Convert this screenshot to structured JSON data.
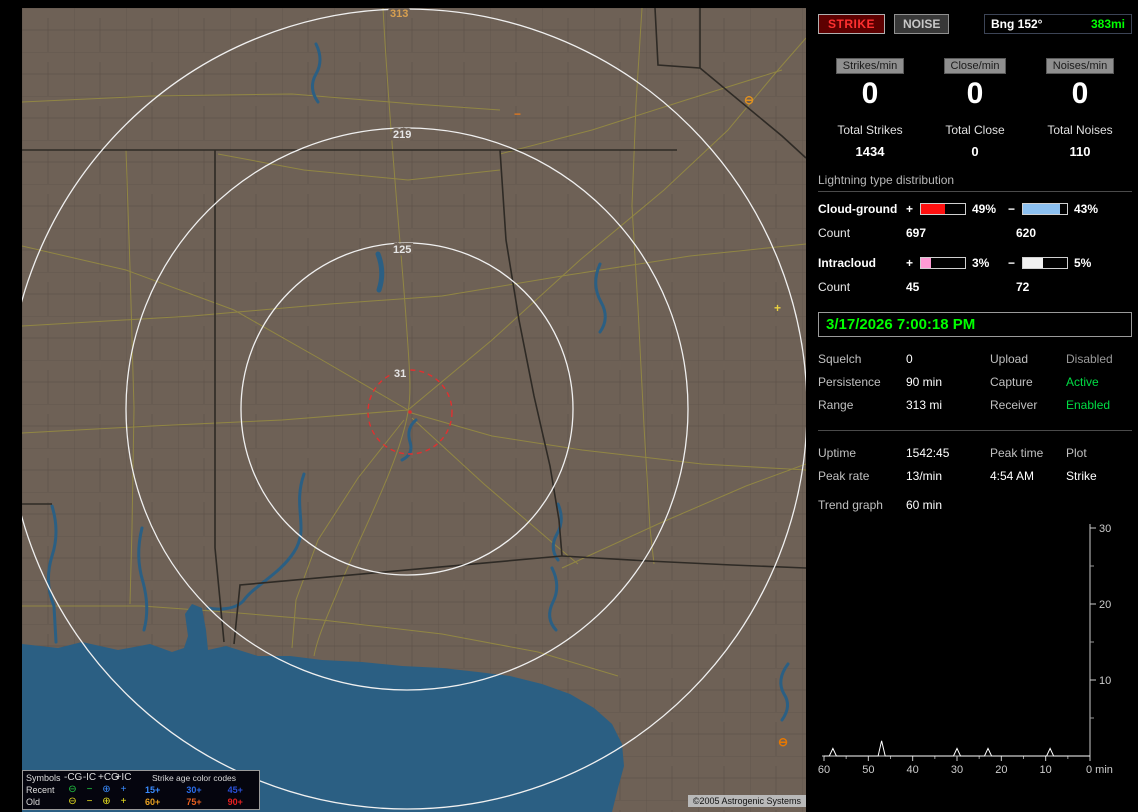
{
  "colors": {
    "accent_green": "#00ff00",
    "status_active": "#00dd44",
    "status_disabled": "#9a9a9a",
    "strike_red": "#ff3030",
    "ring_label": "#e6e6e6",
    "ring_label_outer": "#d8a050",
    "map_land": "#6e6156",
    "map_water": "#2b5f83"
  },
  "map": {
    "rings": [
      {
        "label": "313"
      },
      {
        "label": "219"
      },
      {
        "label": "125"
      },
      {
        "label": "31"
      }
    ],
    "markers": [
      {
        "glyph": "⊖",
        "color": "#e09020"
      },
      {
        "glyph": "−",
        "color": "#e07820"
      },
      {
        "glyph": "+",
        "color": "#e8d040"
      },
      {
        "glyph": "⊖",
        "color": "#e87800"
      }
    ],
    "copyright": "©2005 Astrogenic Systems",
    "legend": {
      "symbols_header": "Symbols",
      "columns": [
        "-CG",
        "-IC",
        "+CG",
        "+IC"
      ],
      "glyphs": [
        "⊖",
        "−",
        "⊕",
        "+"
      ],
      "age_header": "Strike age color codes",
      "recent_label": "Recent",
      "old_label": "Old",
      "recent_ages": [
        "15+",
        "30+",
        "45+"
      ],
      "old_ages": [
        "60+",
        "75+",
        "90+"
      ],
      "recent_symbol_colors": [
        "#22cc44",
        "#22cc44",
        "#3a8cff",
        "#3a8cff"
      ],
      "old_symbol_colors": [
        "#e8e020",
        "#e8e020",
        "#e8e020",
        "#e8e020"
      ],
      "recent_age_colors": [
        "#3a8cff",
        "#2a6ce8",
        "#2a50d8"
      ],
      "old_age_colors": [
        "#e8a020",
        "#e86020",
        "#e82020"
      ]
    }
  },
  "panel": {
    "strike_button": "STRIKE",
    "noise_button": "NOISE",
    "bearing_label": "Bng 152°",
    "bearing_distance": "383mi",
    "counters": [
      {
        "label": "Strikes/min",
        "value": "0",
        "total_label": "Total Strikes",
        "total": "1434"
      },
      {
        "label": "Close/min",
        "value": "0",
        "total_label": "Total Close",
        "total": "0"
      },
      {
        "label": "Noises/min",
        "value": "0",
        "total_label": "Total Noises",
        "total": "110"
      }
    ],
    "distribution": {
      "title": "Lightning type distribution",
      "cloud_ground": {
        "label": "Cloud-ground",
        "plus_sign": "+",
        "minus_sign": "−",
        "plus_pct": "49%",
        "minus_pct": "43%",
        "plus_fill": "55%",
        "minus_fill": "85%",
        "plus_color": "#ff1010",
        "minus_color": "#8cc0f0",
        "count_label": "Count",
        "plus_count": "697",
        "minus_count": "620"
      },
      "intracloud": {
        "label": "Intracloud",
        "plus_sign": "+",
        "minus_sign": "−",
        "plus_pct": "3%",
        "minus_pct": "5%",
        "plus_fill": "22%",
        "minus_fill": "45%",
        "plus_color": "#ff9ad4",
        "minus_color": "#f0f0f0",
        "count_label": "Count",
        "plus_count": "45",
        "minus_count": "72"
      }
    },
    "clock": "3/17/2026 7:00:18 PM",
    "status": {
      "squelch_label": "Squelch",
      "squelch_value": "0",
      "persistence_label": "Persistence",
      "persistence_value": "90 min",
      "range_label": "Range",
      "range_value": "313 mi",
      "upload_label": "Upload",
      "upload_value": "Disabled",
      "capture_label": "Capture",
      "capture_value": "Active",
      "receiver_label": "Receiver",
      "receiver_value": "Enabled"
    },
    "stats": {
      "uptime_label": "Uptime",
      "uptime_value": "1542:45",
      "peak_time_label": "Peak time",
      "peak_time_value": "4:54 AM",
      "plot_label": "Plot",
      "plot_value": "Strike",
      "peak_rate_label": "Peak rate",
      "peak_rate_value": "13/min",
      "trend_label": "Trend graph",
      "trend_value": "60 min"
    }
  },
  "chart_data": {
    "type": "line",
    "title": "Trend graph - strikes per minute, last 60 minutes",
    "xlabel": "min",
    "ylabel": "",
    "x_ticks": [
      60,
      50,
      40,
      30,
      20,
      10,
      0
    ],
    "y_ticks": [
      10,
      20,
      30
    ],
    "ylim": [
      0,
      30
    ],
    "x_axis_note": "minutes ago, 0 at right; y axis drawn on right side",
    "series": [
      {
        "name": "Strike",
        "baseline": 0,
        "spikes": [
          {
            "minutes_ago": 58,
            "value": 1
          },
          {
            "minutes_ago": 47,
            "value": 2
          },
          {
            "minutes_ago": 30,
            "value": 1
          },
          {
            "minutes_ago": 23,
            "value": 1
          },
          {
            "minutes_ago": 9,
            "value": 1
          }
        ]
      }
    ]
  }
}
